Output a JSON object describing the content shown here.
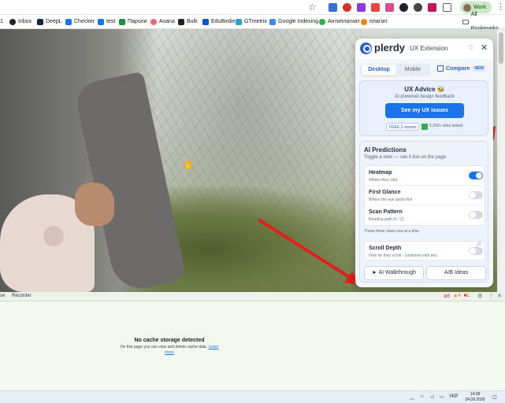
{
  "browser": {
    "profile_label": "Work",
    "all_bookmarks_label": "All Bookmarks",
    "bookmarks": [
      {
        "label": "1"
      },
      {
        "label": "Inbox"
      },
      {
        "label": "DeepL"
      },
      {
        "label": "Checker"
      },
      {
        "label": "test"
      },
      {
        "label": "Пароли"
      },
      {
        "label": "Asana"
      },
      {
        "label": "Bulk"
      },
      {
        "label": "EduBirdie"
      },
      {
        "label": "GTmetrix"
      },
      {
        "label": "Google Indexing"
      },
      {
        "label": "Антиплагиат"
      },
      {
        "label": "плагіат"
      }
    ]
  },
  "plerdy": {
    "brand": "plerdy",
    "product": "UX Extension",
    "tabs": [
      {
        "label": "Desktop",
        "active": true
      },
      {
        "label": "Mobile",
        "active": false
      }
    ],
    "compare_label": "Compare",
    "new_badge": "NEW",
    "advice": {
      "title": "UX Advice 🐝",
      "subtitle": "AI powered design feedback",
      "button": "See my UX issues",
      "reports_badge": "FREE 2 reports",
      "sites_tested": "5,300+ sites tested"
    },
    "ai": {
      "title": "AI Predictions",
      "subtitle": "Toggle a view — see it live on the page",
      "features": [
        {
          "name": "Heatmap",
          "desc": "Where they click",
          "on": true
        },
        {
          "name": "First Glance",
          "desc": "Where the eye lands first",
          "on": false
        },
        {
          "name": "Scan Pattern",
          "desc": "Reading path (F / Z)",
          "on": false
        }
      ],
      "note": "These three show one at a time",
      "scroll": {
        "name": "Scroll Depth",
        "desc": "How far they scroll - combines with any",
        "on": false
      },
      "walkthrough_button": "► AI Walkthrough",
      "ab_button": "A/B Ideas"
    }
  },
  "devtools": {
    "tabs": [
      "se",
      "Recorder"
    ],
    "errors": "5",
    "warnings": "4",
    "issues": "1",
    "cache_title": "No cache storage detected",
    "cache_desc": "On this page you can view and delete cache data.",
    "learn_more": "Learn more"
  },
  "taskbar": {
    "lang": "УКР",
    "time": "14:28",
    "date": "24.09.2026"
  }
}
